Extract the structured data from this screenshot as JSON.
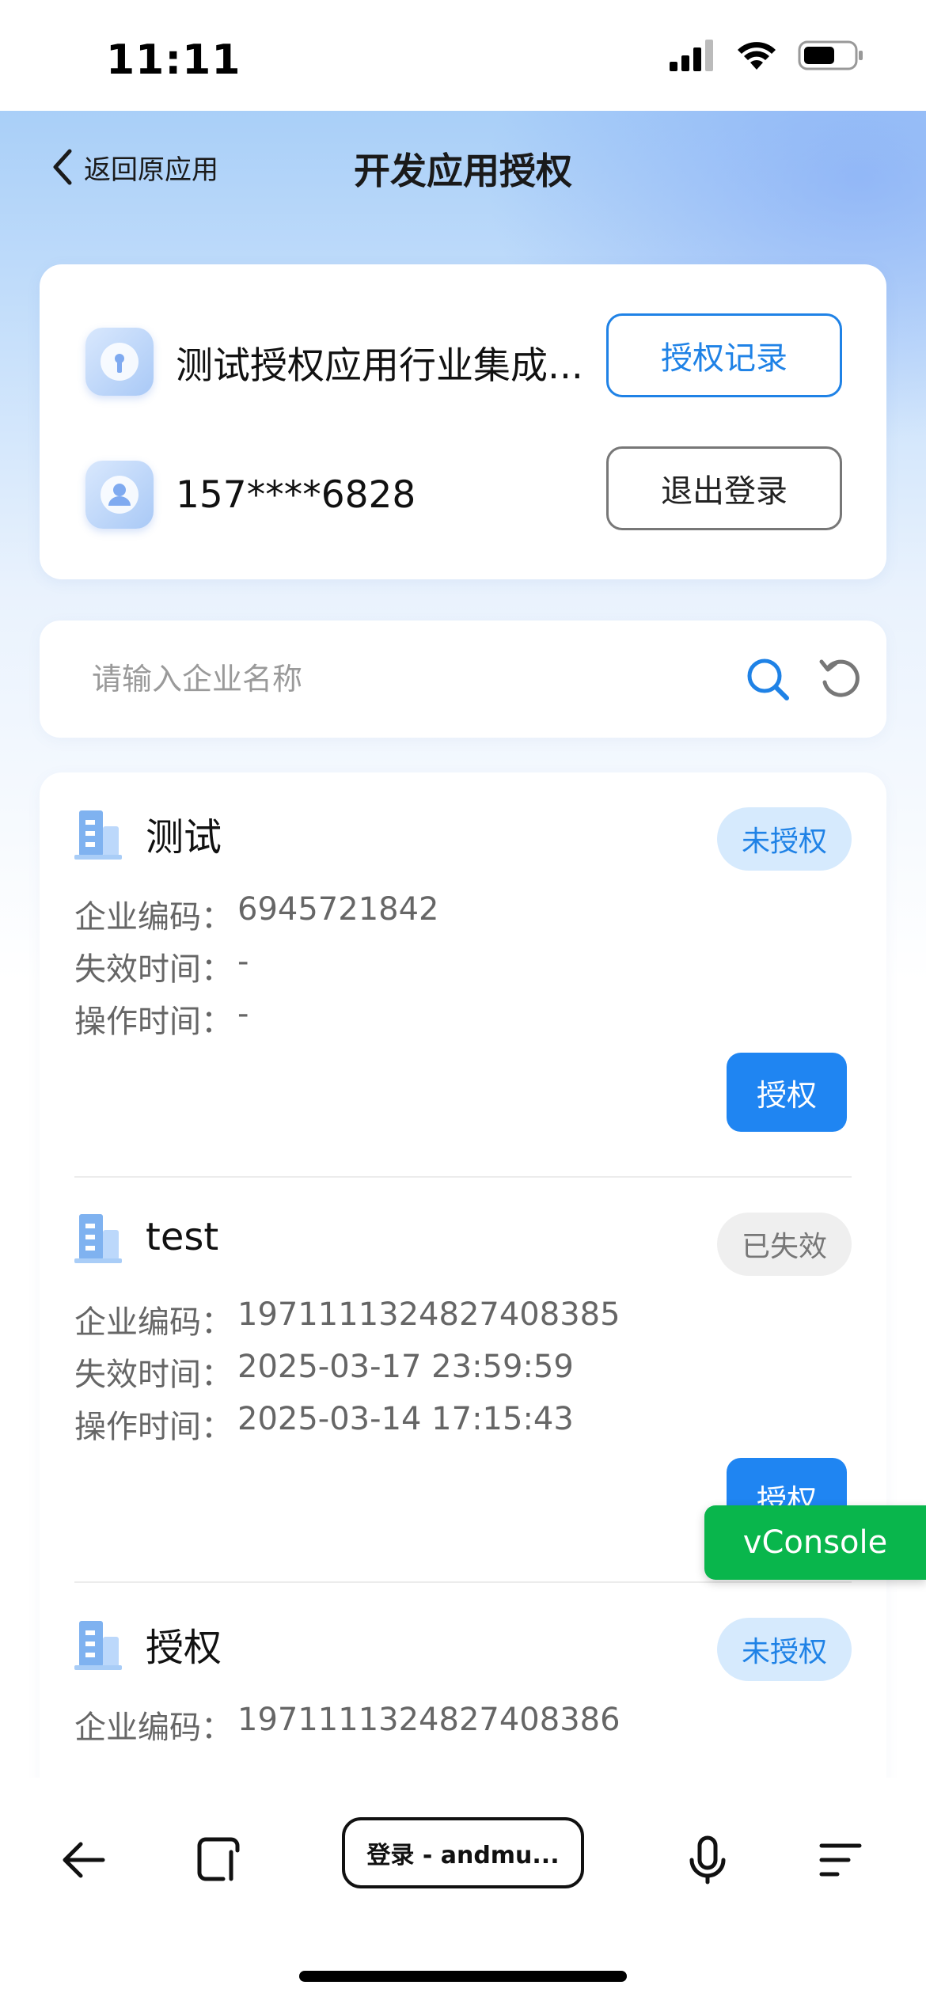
{
  "status_bar": {
    "time": "11:11"
  },
  "nav": {
    "back_label": "返回原应用",
    "title": "开发应用授权"
  },
  "account": {
    "app_name": "测试授权应用行业集成...",
    "phone": "157****6828",
    "records_button": "授权记录",
    "logout_button": "退出登录"
  },
  "search": {
    "placeholder": "请输入企业名称"
  },
  "enterprises": [
    {
      "name": "测试",
      "status": "未授权",
      "code_label": "企业编码：",
      "code": "6945721842",
      "expire_label": "失效时间：",
      "expire": "-",
      "op_label": "操作时间：",
      "op": "-",
      "action": "授权"
    },
    {
      "name": "test",
      "status": "已失效",
      "code_label": "企业编码：",
      "code": "1971111324827408385",
      "expire_label": "失效时间：",
      "expire": "2025-03-17 23:59:59",
      "op_label": "操作时间：",
      "op": "2025-03-14 17:15:43",
      "action": "授权"
    },
    {
      "name": "授权",
      "status": "未授权",
      "code_label": "企业编码：",
      "code": "1971111324827408386"
    }
  ],
  "vconsole": {
    "label": "vConsole"
  },
  "browser": {
    "url_label": "登录 - andmu..."
  },
  "colors": {
    "accent": "#1f82e6",
    "button_blue": "#1f85f2",
    "vconsole_green": "#09b64c"
  }
}
